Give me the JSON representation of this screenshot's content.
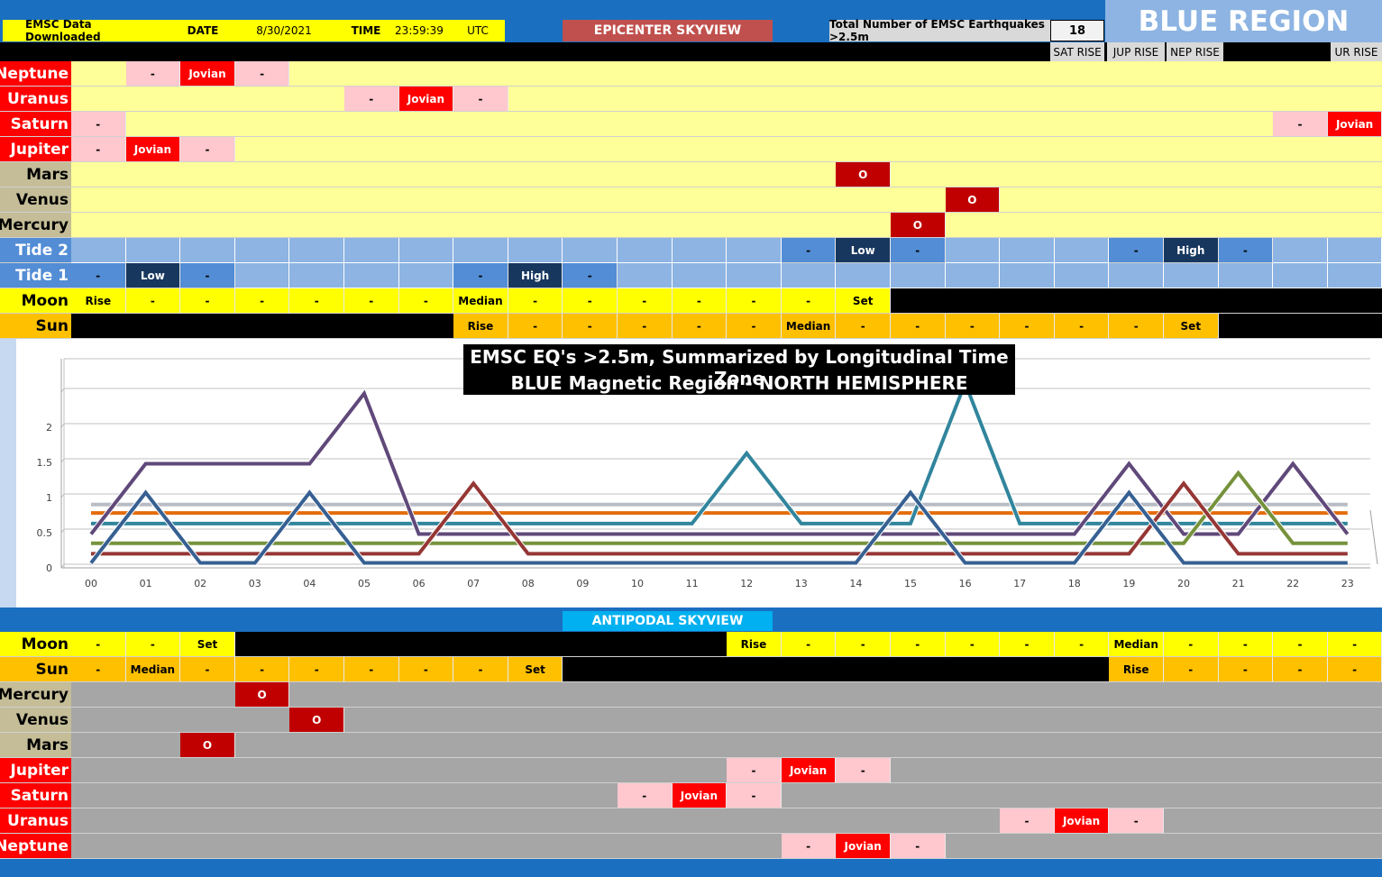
{
  "header": {
    "downloaded_label": "EMSC Data Downloaded",
    "date_label": "DATE",
    "date_value": "8/30/2021",
    "time_label": "TIME",
    "time_value": "23:59:39",
    "tz": "UTC",
    "skyview_title": "EPICENTER SKYVIEW",
    "total_label": "Total Number of EMSC Earthquakes >2.5m",
    "total_value": "18",
    "region_title": "BLUE REGION",
    "rise_labels": {
      "sat": "SAT RISE",
      "jup": "JUP RISE",
      "nep": "NEP RISE",
      "ur": "UR RISE"
    }
  },
  "colors": {
    "yellow": "#ffff99",
    "bright_yellow": "#ffff00",
    "orange": "#ffc000",
    "pink": "#ffc7ce",
    "red": "#ff0000",
    "darkred": "#c00000",
    "tan": "#c4bd97",
    "blue_light": "#8db4e2",
    "blue_mid": "#538dd5",
    "navy": "#17375e",
    "black": "#000000",
    "gray": "#a6a6a6"
  },
  "epicenter": {
    "rows": [
      {
        "label": "Neptune",
        "label_bg": "red",
        "label_color": "#ffffff",
        "bg": "yellow",
        "cells": [
          {
            "c": 1,
            "t": "-",
            "bg": "pink"
          },
          {
            "c": 2,
            "t": "Jovian",
            "bg": "red"
          },
          {
            "c": 3,
            "t": "-",
            "bg": "pink"
          }
        ]
      },
      {
        "label": "Uranus",
        "label_bg": "red",
        "label_color": "#ffffff",
        "bg": "yellow",
        "cells": [
          {
            "c": 5,
            "t": "-",
            "bg": "pink"
          },
          {
            "c": 6,
            "t": "Jovian",
            "bg": "red"
          },
          {
            "c": 7,
            "t": "-",
            "bg": "pink"
          }
        ]
      },
      {
        "label": "Saturn",
        "label_bg": "red",
        "label_color": "#ffffff",
        "bg": "yellow",
        "cells": [
          {
            "c": 0,
            "t": "-",
            "bg": "pink"
          },
          {
            "c": 22,
            "t": "-",
            "bg": "pink"
          },
          {
            "c": 23,
            "t": "Jovian",
            "bg": "red"
          }
        ]
      },
      {
        "label": "Jupiter",
        "label_bg": "red",
        "label_color": "#ffffff",
        "bg": "yellow",
        "cells": [
          {
            "c": 0,
            "t": "-",
            "bg": "pink"
          },
          {
            "c": 1,
            "t": "Jovian",
            "bg": "red"
          },
          {
            "c": 2,
            "t": "-",
            "bg": "pink"
          }
        ]
      },
      {
        "label": "Mars",
        "label_bg": "tan",
        "label_color": "#000000",
        "bg": "yellow",
        "cells": [
          {
            "c": 14,
            "t": "O",
            "bg": "darkred"
          }
        ]
      },
      {
        "label": "Venus",
        "label_bg": "tan",
        "label_color": "#000000",
        "bg": "yellow",
        "cells": [
          {
            "c": 16,
            "t": "O",
            "bg": "darkred"
          }
        ]
      },
      {
        "label": "Mercury",
        "label_bg": "tan",
        "label_color": "#000000",
        "bg": "yellow",
        "cells": [
          {
            "c": 15,
            "t": "O",
            "bg": "darkred"
          }
        ]
      },
      {
        "label": "Tide 2",
        "label_bg": "blue_mid",
        "label_color": "#ffffff",
        "bg": "blue_light",
        "cells": [
          {
            "c": 13,
            "t": "-",
            "bg": "blue_mid"
          },
          {
            "c": 14,
            "t": "Low",
            "bg": "navy"
          },
          {
            "c": 15,
            "t": "-",
            "bg": "blue_mid"
          },
          {
            "c": 19,
            "t": "-",
            "bg": "blue_mid"
          },
          {
            "c": 20,
            "t": "High",
            "bg": "navy"
          },
          {
            "c": 21,
            "t": "-",
            "bg": "blue_mid"
          }
        ]
      },
      {
        "label": "Tide 1",
        "label_bg": "blue_mid",
        "label_color": "#ffffff",
        "bg": "blue_light",
        "cells": [
          {
            "c": 0,
            "t": "-",
            "bg": "blue_mid"
          },
          {
            "c": 1,
            "t": "Low",
            "bg": "navy"
          },
          {
            "c": 2,
            "t": "-",
            "bg": "blue_mid"
          },
          {
            "c": 7,
            "t": "-",
            "bg": "blue_mid"
          },
          {
            "c": 8,
            "t": "High",
            "bg": "navy"
          },
          {
            "c": 9,
            "t": "-",
            "bg": "blue_mid"
          }
        ]
      },
      {
        "label": "Moon",
        "label_bg": "bright_yellow",
        "label_color": "#000000",
        "bg": "black",
        "cells": [
          {
            "c": 0,
            "t": "Rise",
            "bg": "bright_yellow"
          },
          {
            "c": 1,
            "t": "-",
            "bg": "bright_yellow"
          },
          {
            "c": 2,
            "t": "-",
            "bg": "bright_yellow"
          },
          {
            "c": 3,
            "t": "-",
            "bg": "bright_yellow"
          },
          {
            "c": 4,
            "t": "-",
            "bg": "bright_yellow"
          },
          {
            "c": 5,
            "t": "-",
            "bg": "bright_yellow"
          },
          {
            "c": 6,
            "t": "-",
            "bg": "bright_yellow"
          },
          {
            "c": 7,
            "t": "Median",
            "bg": "bright_yellow"
          },
          {
            "c": 8,
            "t": "-",
            "bg": "bright_yellow"
          },
          {
            "c": 9,
            "t": "-",
            "bg": "bright_yellow"
          },
          {
            "c": 10,
            "t": "-",
            "bg": "bright_yellow"
          },
          {
            "c": 11,
            "t": "-",
            "bg": "bright_yellow"
          },
          {
            "c": 12,
            "t": "-",
            "bg": "bright_yellow"
          },
          {
            "c": 13,
            "t": "-",
            "bg": "bright_yellow"
          },
          {
            "c": 14,
            "t": "Set",
            "bg": "bright_yellow"
          }
        ]
      },
      {
        "label": "Sun",
        "label_bg": "orange",
        "label_color": "#000000",
        "bg": "black",
        "cells": [
          {
            "c": 7,
            "t": "Rise",
            "bg": "orange"
          },
          {
            "c": 8,
            "t": "-",
            "bg": "orange"
          },
          {
            "c": 9,
            "t": "-",
            "bg": "orange"
          },
          {
            "c": 10,
            "t": "-",
            "bg": "orange"
          },
          {
            "c": 11,
            "t": "-",
            "bg": "orange"
          },
          {
            "c": 12,
            "t": "-",
            "bg": "orange"
          },
          {
            "c": 13,
            "t": "Median",
            "bg": "orange"
          },
          {
            "c": 14,
            "t": "-",
            "bg": "orange"
          },
          {
            "c": 15,
            "t": "-",
            "bg": "orange"
          },
          {
            "c": 16,
            "t": "-",
            "bg": "orange"
          },
          {
            "c": 17,
            "t": "-",
            "bg": "orange"
          },
          {
            "c": 18,
            "t": "-",
            "bg": "orange"
          },
          {
            "c": 19,
            "t": "-",
            "bg": "orange"
          },
          {
            "c": 20,
            "t": "Set",
            "bg": "orange"
          }
        ]
      }
    ]
  },
  "antipodal": {
    "title": "ANTIPODAL SKYVIEW",
    "rows": [
      {
        "label": "Moon",
        "label_bg": "bright_yellow",
        "label_color": "#000000",
        "bg": "black",
        "cells": [
          {
            "c": 0,
            "t": "-",
            "bg": "bright_yellow"
          },
          {
            "c": 1,
            "t": "-",
            "bg": "bright_yellow"
          },
          {
            "c": 2,
            "t": "Set",
            "bg": "bright_yellow"
          },
          {
            "c": 12,
            "t": "Rise",
            "bg": "bright_yellow"
          },
          {
            "c": 13,
            "t": "-",
            "bg": "bright_yellow"
          },
          {
            "c": 14,
            "t": "-",
            "bg": "bright_yellow"
          },
          {
            "c": 15,
            "t": "-",
            "bg": "bright_yellow"
          },
          {
            "c": 16,
            "t": "-",
            "bg": "bright_yellow"
          },
          {
            "c": 17,
            "t": "-",
            "bg": "bright_yellow"
          },
          {
            "c": 18,
            "t": "-",
            "bg": "bright_yellow"
          },
          {
            "c": 19,
            "t": "Median",
            "bg": "bright_yellow"
          },
          {
            "c": 20,
            "t": "-",
            "bg": "bright_yellow"
          },
          {
            "c": 21,
            "t": "-",
            "bg": "bright_yellow"
          },
          {
            "c": 22,
            "t": "-",
            "bg": "bright_yellow"
          },
          {
            "c": 23,
            "t": "-",
            "bg": "bright_yellow"
          }
        ]
      },
      {
        "label": "Sun",
        "label_bg": "orange",
        "label_color": "#000000",
        "bg": "black",
        "cells": [
          {
            "c": 0,
            "t": "-",
            "bg": "orange"
          },
          {
            "c": 1,
            "t": "Median",
            "bg": "orange"
          },
          {
            "c": 2,
            "t": "-",
            "bg": "orange"
          },
          {
            "c": 3,
            "t": "-",
            "bg": "orange"
          },
          {
            "c": 4,
            "t": "-",
            "bg": "orange"
          },
          {
            "c": 5,
            "t": "-",
            "bg": "orange"
          },
          {
            "c": 6,
            "t": "-",
            "bg": "orange"
          },
          {
            "c": 7,
            "t": "-",
            "bg": "orange"
          },
          {
            "c": 8,
            "t": "Set",
            "bg": "orange"
          },
          {
            "c": 19,
            "t": "Rise",
            "bg": "orange"
          },
          {
            "c": 20,
            "t": "-",
            "bg": "orange"
          },
          {
            "c": 21,
            "t": "-",
            "bg": "orange"
          },
          {
            "c": 22,
            "t": "-",
            "bg": "orange"
          },
          {
            "c": 23,
            "t": "-",
            "bg": "orange"
          }
        ]
      },
      {
        "label": "Mercury",
        "label_bg": "tan",
        "label_color": "#000000",
        "bg": "gray",
        "cells": [
          {
            "c": 3,
            "t": "O",
            "bg": "darkred"
          }
        ]
      },
      {
        "label": "Venus",
        "label_bg": "tan",
        "label_color": "#000000",
        "bg": "gray",
        "cells": [
          {
            "c": 4,
            "t": "O",
            "bg": "darkred"
          }
        ]
      },
      {
        "label": "Mars",
        "label_bg": "tan",
        "label_color": "#000000",
        "bg": "gray",
        "cells": [
          {
            "c": 2,
            "t": "O",
            "bg": "darkred"
          }
        ]
      },
      {
        "label": "Jupiter",
        "label_bg": "red",
        "label_color": "#ffffff",
        "bg": "gray",
        "cells": [
          {
            "c": 12,
            "t": "-",
            "bg": "pink"
          },
          {
            "c": 13,
            "t": "Jovian",
            "bg": "red"
          },
          {
            "c": 14,
            "t": "-",
            "bg": "pink"
          }
        ]
      },
      {
        "label": "Saturn",
        "label_bg": "red",
        "label_color": "#ffffff",
        "bg": "gray",
        "cells": [
          {
            "c": 10,
            "t": "-",
            "bg": "pink"
          },
          {
            "c": 11,
            "t": "Jovian",
            "bg": "red"
          },
          {
            "c": 12,
            "t": "-",
            "bg": "pink"
          }
        ]
      },
      {
        "label": "Uranus",
        "label_bg": "red",
        "label_color": "#ffffff",
        "bg": "gray",
        "cells": [
          {
            "c": 17,
            "t": "-",
            "bg": "pink"
          },
          {
            "c": 18,
            "t": "Jovian",
            "bg": "red"
          },
          {
            "c": 19,
            "t": "-",
            "bg": "pink"
          }
        ]
      },
      {
        "label": "Neptune",
        "label_bg": "red",
        "label_color": "#ffffff",
        "bg": "gray",
        "cells": [
          {
            "c": 13,
            "t": "-",
            "bg": "pink"
          },
          {
            "c": 14,
            "t": "Jovian",
            "bg": "red"
          },
          {
            "c": 15,
            "t": "-",
            "bg": "pink"
          }
        ]
      }
    ]
  },
  "chart_data": {
    "type": "line",
    "title": "EMSC EQ's >2.5m, Summarized  by Longitudinal Time Zone",
    "subtitle": "BLUE Magnetic Region  - NORTH HEMISPHERE",
    "categories": [
      "00",
      "01",
      "02",
      "03",
      "04",
      "05",
      "06",
      "07",
      "08",
      "09",
      "10",
      "11",
      "12",
      "13",
      "14",
      "15",
      "16",
      "17",
      "18",
      "19",
      "20",
      "21",
      "22",
      "23"
    ],
    "yticks": [
      "0",
      "0.5",
      "1",
      "1.5",
      "2"
    ],
    "ylim": [
      0,
      2.5
    ],
    "grid": true,
    "legend": "none",
    "series": [
      {
        "color": "#b8bcc4",
        "values": [
          0.9,
          0.9,
          0.9,
          0.9,
          0.9,
          0.9,
          0.9,
          0.9,
          0.9,
          0.9,
          0.9,
          0.9,
          0.9,
          0.9,
          0.9,
          0.9,
          0.9,
          0.9,
          0.9,
          0.9,
          0.9,
          0.9,
          0.9,
          0.9
        ]
      },
      {
        "color": "#e46c0a",
        "values": [
          0.78,
          0.78,
          0.78,
          0.78,
          0.78,
          0.78,
          0.78,
          0.78,
          0.78,
          0.78,
          0.78,
          0.78,
          0.78,
          0.78,
          0.78,
          0.78,
          0.78,
          0.78,
          0.78,
          0.78,
          0.78,
          0.78,
          0.78,
          0.78
        ]
      },
      {
        "color": "#31859c",
        "values": [
          0.63,
          0.63,
          0.63,
          0.63,
          0.63,
          0.63,
          0.63,
          0.63,
          0.63,
          0.63,
          0.63,
          0.63,
          1.63,
          0.63,
          0.63,
          0.63,
          2.63,
          0.63,
          0.63,
          0.63,
          0.63,
          0.63,
          0.63,
          0.63
        ]
      },
      {
        "color": "#60497a",
        "values": [
          0.48,
          1.48,
          1.48,
          1.48,
          1.48,
          2.48,
          0.48,
          0.48,
          0.48,
          0.48,
          0.48,
          0.48,
          0.48,
          0.48,
          0.48,
          0.48,
          0.48,
          0.48,
          0.48,
          1.48,
          0.48,
          0.48,
          1.48,
          0.48
        ]
      },
      {
        "color": "#76923c",
        "values": [
          0.35,
          0.35,
          0.35,
          0.35,
          0.35,
          0.35,
          0.35,
          0.35,
          0.35,
          0.35,
          0.35,
          0.35,
          0.35,
          0.35,
          0.35,
          0.35,
          0.35,
          0.35,
          0.35,
          0.35,
          0.35,
          1.35,
          0.35,
          0.35
        ]
      },
      {
        "color": "#953735",
        "values": [
          0.2,
          0.2,
          0.2,
          0.2,
          0.2,
          0.2,
          0.2,
          1.2,
          0.2,
          0.2,
          0.2,
          0.2,
          0.2,
          0.2,
          0.2,
          0.2,
          0.2,
          0.2,
          0.2,
          0.2,
          1.2,
          0.2,
          0.2,
          0.2
        ]
      },
      {
        "color": "#376092",
        "values": [
          0.07,
          1.07,
          0.07,
          0.07,
          1.07,
          0.07,
          0.07,
          0.07,
          0.07,
          0.07,
          0.07,
          0.07,
          0.07,
          0.07,
          0.07,
          1.07,
          0.07,
          0.07,
          0.07,
          1.07,
          0.07,
          0.07,
          0.07,
          0.07
        ]
      }
    ]
  }
}
